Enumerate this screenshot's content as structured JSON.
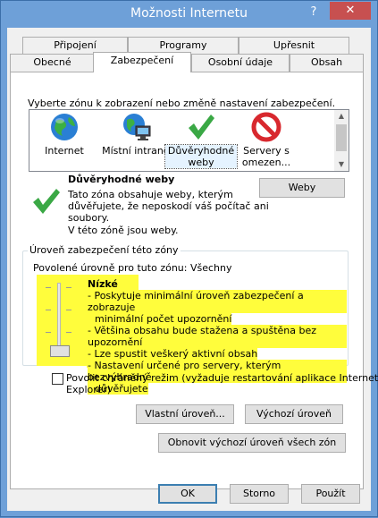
{
  "window": {
    "title": "Možnosti Internetu",
    "help_glyph": "?",
    "close_glyph": "✕"
  },
  "tabs_row1": [
    {
      "label": "Připojení"
    },
    {
      "label": "Programy"
    },
    {
      "label": "Upřesnit"
    }
  ],
  "tabs_row2": [
    {
      "label": "Obecné"
    },
    {
      "label": "Zabezpečení",
      "active": true
    },
    {
      "label": "Osobní údaje"
    },
    {
      "label": "Obsah"
    }
  ],
  "security": {
    "instruction": "Vyberte zónu k zobrazení nebo změně nastavení zabezpečení.",
    "zones": [
      {
        "label_line1": "Internet",
        "label_line2": "",
        "icon": "globe-icon"
      },
      {
        "label_line1": "Místní intranet",
        "label_line2": "",
        "icon": "intranet-icon"
      },
      {
        "label_line1": "Důvěryhodné",
        "label_line2": "weby",
        "icon": "checkmark-icon",
        "selected": true
      },
      {
        "label_line1": "Servery s",
        "label_line2": "omezen...",
        "icon": "restricted-icon"
      }
    ],
    "zone_title": "Důvěryhodné weby",
    "zone_desc_1": "Tato zóna obsahuje weby, kterým",
    "zone_desc_2": "důvěřujete, že neposkodí váš počítač ani",
    "zone_desc_3": "soubory.",
    "zone_desc_4": "V této zóně jsou weby.",
    "sites_button": "Weby",
    "group_label": "Úroveň zabezpečení této zóny",
    "allowed_levels": "Povolené úrovně pro tuto zónu: Všechny",
    "level_name": "Nízké",
    "level_points": [
      "- Poskytuje minimální úroveň zabezpečení a zobrazuje",
      "minimální počet upozornění",
      "- Většina obsahu bude stažena a spuštěna bez upozornění",
      "- Lze spustit veškerý aktivní obsah",
      "- Nastavení určené pro servery, kterým bezvýhradně",
      "důvěřujete"
    ],
    "protected_mode_label_1": "Povolit chráněný režim (vyžaduje restartování aplikace Internet",
    "protected_mode_label_2": "Explorer)",
    "protected_mode_checked": false,
    "custom_level_button": "Vlastní úroveň...",
    "default_level_button": "Výchozí úroveň",
    "reset_all_button": "Obnovit výchozí úroveň všech zón"
  },
  "footer": {
    "ok": "OK",
    "cancel": "Storno",
    "apply": "Použít"
  }
}
